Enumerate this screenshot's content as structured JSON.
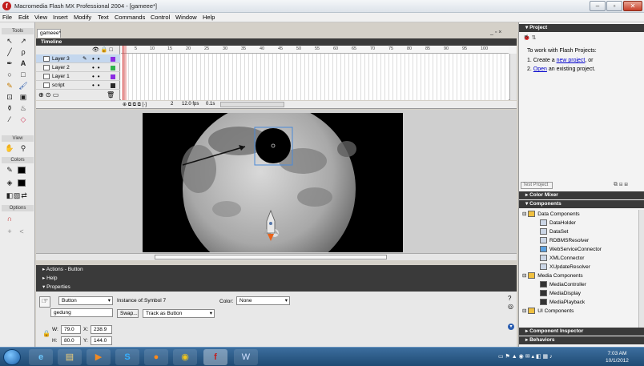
{
  "window": {
    "title": "Macromedia Flash MX Professional 2004 - [gameee*]",
    "app_icon": "flash-app-icon"
  },
  "menu": [
    "File",
    "Edit",
    "View",
    "Insert",
    "Modify",
    "Text",
    "Commands",
    "Control",
    "Window",
    "Help"
  ],
  "tools": {
    "title": "Tools",
    "view": "View",
    "colors": "Colors",
    "options": "Options"
  },
  "document": {
    "tab": "gameee*"
  },
  "timeline": {
    "header": "Timeline",
    "layers": [
      {
        "name": "Layer 3",
        "color": "#8b2be2"
      },
      {
        "name": "Layer 2",
        "color": "#2fb34a"
      },
      {
        "name": "Layer 1",
        "color": "#8b2be2"
      },
      {
        "name": "script",
        "color": "#2a2a2a"
      }
    ],
    "ruler": [
      "5",
      "10",
      "15",
      "20",
      "25",
      "30",
      "35",
      "40",
      "45",
      "50",
      "55",
      "60",
      "65",
      "70",
      "75",
      "80",
      "85",
      "90",
      "95",
      "100"
    ],
    "frame": "2",
    "fps": "12.0 fps",
    "time": "0.1s"
  },
  "panels": {
    "actions": "Actions - Button",
    "help": "Help",
    "properties": "Properties"
  },
  "properties": {
    "type": "Button",
    "instance_name": "gedung",
    "instance_of_label": "Instance of:",
    "instance_of": "Symbol 7",
    "swap": "Swap...",
    "track": "Track as Button",
    "color_label": "Color:",
    "color_value": "None",
    "w_label": "W:",
    "w": "79.0",
    "x_label": "X:",
    "x": "238.9",
    "h_label": "H:",
    "h": "80.0",
    "y_label": "Y:",
    "y": "144.0"
  },
  "project": {
    "header": "Project",
    "intro": "To work with Flash Projects:",
    "step1_pre": "1. Create a ",
    "step1_link": "new project",
    "step1_post": ", or",
    "step2_pre": "2. ",
    "step2_link": "Open",
    "step2_post": " an existing project.",
    "test": "Test Project"
  },
  "right_panels": {
    "color_mixer": "Color Mixer",
    "components": "Components",
    "inspector": "Component Inspector",
    "behaviors": "Behaviors"
  },
  "components": {
    "groups": [
      {
        "name": "Data Components",
        "items": [
          "DataHolder",
          "DataSet",
          "RDBMSResolver",
          "WebServiceConnector",
          "XMLConnector",
          "XUpdateResolver"
        ]
      },
      {
        "name": "Media Components",
        "items": [
          "MediaController",
          "MediaDisplay",
          "MediaPlayback"
        ]
      },
      {
        "name": "UI Components",
        "items": []
      }
    ]
  },
  "taskbar": {
    "time": "7:03 AM",
    "date": "10/1/2012"
  }
}
